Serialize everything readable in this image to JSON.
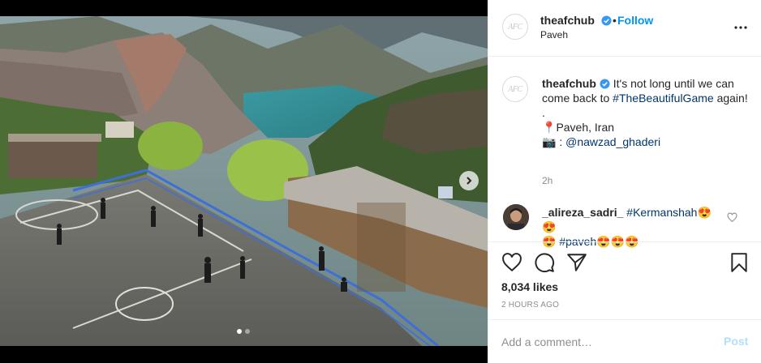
{
  "post": {
    "username": "theafchub",
    "follow_label": "Follow",
    "separator": "•",
    "location": "Paveh",
    "avatar_logo": "AFC",
    "options_icon": "more-horizontal-icon"
  },
  "caption": {
    "username": "theafchub",
    "text_before": " It's not long until we can come back to ",
    "hashtag": "#TheBeautifulGame",
    "text_after": " again!",
    "dot_line": ".",
    "pin_emoji": "📍",
    "location_line": "Paveh, Iran",
    "camera_emoji": "📷",
    "credit_prefix": " : ",
    "credit_handle": "@nawzad_ghaderi",
    "time": "2h"
  },
  "comment": {
    "username": "_alireza_sadri_",
    "hashtag1": "#Kermanshah",
    "emojis1": "😍😍",
    "emojis2": "😍",
    "hashtag2": "#paveh",
    "emojis3": "😍😍😍"
  },
  "actions": {
    "likes": "8,034 likes",
    "time_ago": "2 HOURS AGO"
  },
  "add_comment": {
    "placeholder": "Add a comment…",
    "post_label": "Post"
  },
  "carousel": {
    "slide_count": 2,
    "active_index": 0
  },
  "colors": {
    "link": "#0095f6",
    "hashtag": "#00376b",
    "post_disabled": "#b2dffc",
    "muted": "#8e8e8e"
  }
}
